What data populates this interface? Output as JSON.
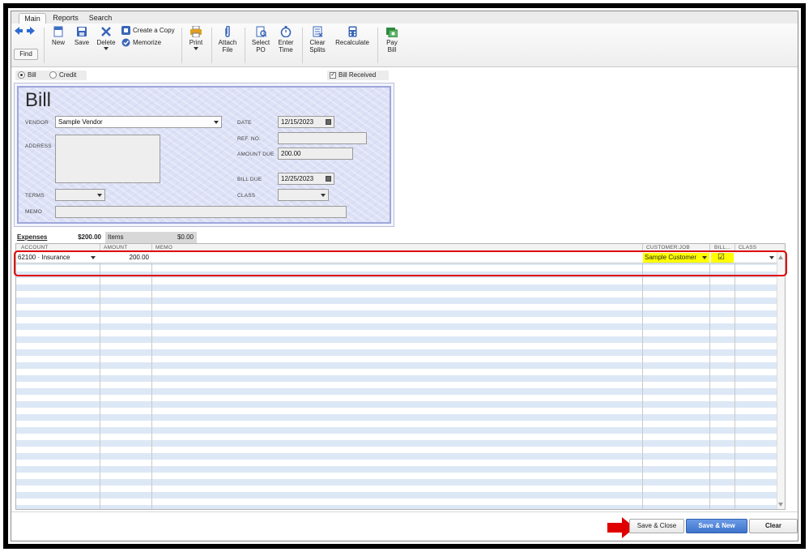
{
  "tabs": [
    {
      "label": "Main"
    },
    {
      "label": "Reports"
    },
    {
      "label": "Search"
    }
  ],
  "toolbar": {
    "find": "Find",
    "new": "New",
    "save": "Save",
    "delete": "Delete",
    "create_copy": "Create a Copy",
    "memorize": "Memorize",
    "print": "Print",
    "attach_file_1": "Attach",
    "attach_file_2": "File",
    "select_po_1": "Select",
    "select_po_2": "PO",
    "enter_time_1": "Enter",
    "enter_time_2": "Time",
    "clear_splits_1": "Clear",
    "clear_splits_2": "Splits",
    "recalculate": "Recalculate",
    "pay_bill_1": "Pay",
    "pay_bill_2": "Bill"
  },
  "mode": {
    "bill": "Bill",
    "credit": "Credit",
    "bill_received": "Bill Received"
  },
  "form": {
    "title": "Bill",
    "vendor_label": "VENDOR",
    "vendor": "Sample Vendor",
    "address_label": "ADDRESS",
    "terms_label": "TERMS",
    "memo_label": "MEMO",
    "date_label": "DATE",
    "date": "12/15/2023",
    "ref_label": "REF. NO.",
    "amount_due_label": "AMOUNT DUE",
    "amount_due": "200.00",
    "bill_due_label": "BILL DUE",
    "bill_due": "12/25/2023",
    "class_label": "CLASS"
  },
  "split_tabs": {
    "expenses_label": "Expenses",
    "expenses_amount": "$200.00",
    "items_label": "Items",
    "items_amount": "$0.00"
  },
  "grid": {
    "headers": {
      "account": "ACCOUNT",
      "amount": "AMOUNT",
      "memo": "MEMO",
      "customer_job": "CUSTOMER:JOB",
      "billable": "BILL...",
      "class": "CLASS"
    },
    "rows": [
      {
        "account": "62100 · Insurance",
        "amount": "200.00",
        "memo": "",
        "customer_job": "Sample Customer",
        "billable": "☑"
      }
    ]
  },
  "footer": {
    "save_close": "Save & Close",
    "save_new": "Save & New",
    "clear": "Clear"
  },
  "colors": {
    "highlight": "#ffff00",
    "annotation": "#e00000",
    "primary_button": "#3f74cc"
  }
}
